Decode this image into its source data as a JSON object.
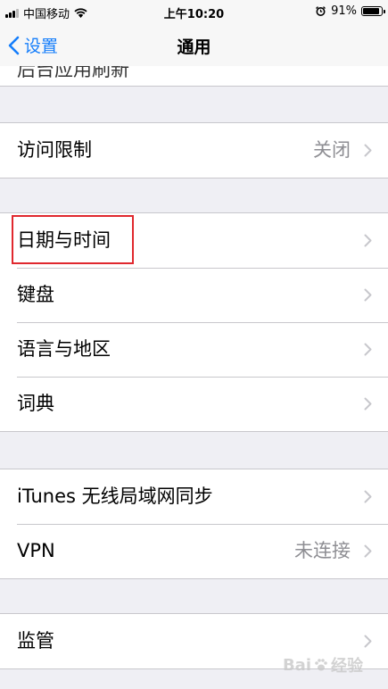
{
  "status_bar": {
    "carrier": "中国移动",
    "time": "上午10:20",
    "battery_percent": "91%",
    "battery_level": 0.91
  },
  "nav": {
    "back_label": "设置",
    "title": "通用"
  },
  "partial_row": {
    "label": "后台应用刷新"
  },
  "groups": [
    {
      "rows": [
        {
          "label": "访问限制",
          "value": "关闭"
        }
      ]
    },
    {
      "rows": [
        {
          "label": "日期与时间",
          "value": ""
        },
        {
          "label": "键盘",
          "value": ""
        },
        {
          "label": "语言与地区",
          "value": ""
        },
        {
          "label": "词典",
          "value": ""
        }
      ]
    },
    {
      "rows": [
        {
          "label": "iTunes 无线局域网同步",
          "value": ""
        },
        {
          "label": "VPN",
          "value": "未连接"
        }
      ]
    },
    {
      "rows": [
        {
          "label": "监管",
          "value": ""
        }
      ]
    }
  ],
  "watermark": {
    "text_left": "Bai",
    "text_right": "经验"
  },
  "colors": {
    "accent": "#157efb",
    "highlight": "#e0282e",
    "background": "#efeff4"
  }
}
